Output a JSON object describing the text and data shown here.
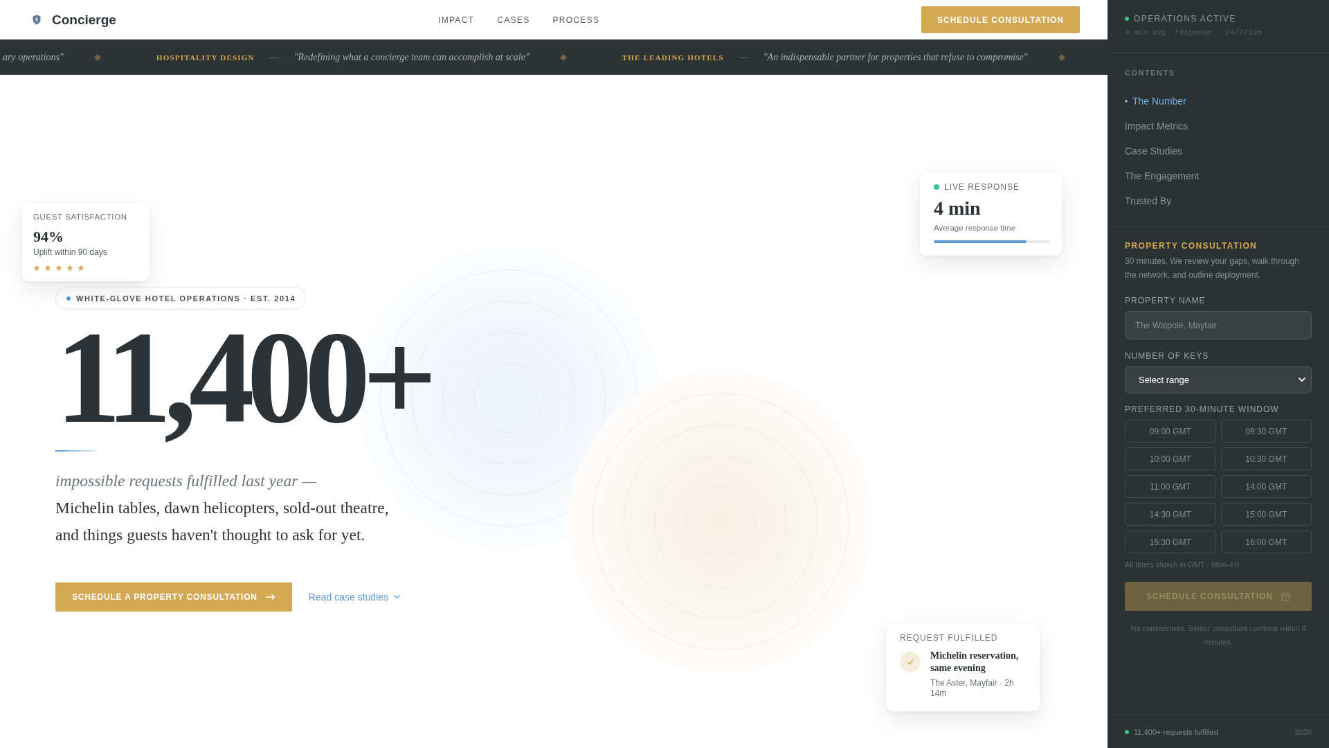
{
  "header": {
    "logo": "Concierge",
    "nav": [
      "IMPACT",
      "CASES",
      "PROCESS"
    ],
    "cta": "SCHEDULE CONSULTATION"
  },
  "ticker": {
    "entries": [
      {
        "quote": "ary operations\""
      },
      {
        "label": "HOSPITALITY DESIGN",
        "dash": "—",
        "quote": "\"Redefining what a concierge team can accomplish at scale\""
      },
      {
        "label": "THE LEADING HOTELS",
        "dash": "—",
        "quote": "\"An indispensable partner for properties that refuse to compromise\""
      }
    ]
  },
  "hero": {
    "badge": "WHITE-GLOVE HOTEL OPERATIONS · EST. 2014",
    "number": "11,400+",
    "lead": "impossible requests fulfilled last year —",
    "body": "Michelin tables, dawn helicopters, sold-out theatre, and things guests haven't thought to ask for yet.",
    "primary_button": "SCHEDULE A PROPERTY CONSULTATION",
    "secondary_link": "Read case studies"
  },
  "cards": [
    {
      "kind": "live",
      "title": "LIVE RESPONSE",
      "value": "4 min",
      "caption": "Average response time",
      "level": 0.8
    },
    {
      "kind": "satisfaction",
      "title": "GUEST SATISFACTION",
      "value": "94%",
      "caption": "Uplift within 90 days",
      "stars": 5
    },
    {
      "kind": "fulfilled",
      "title": "REQUEST FULFILLED",
      "headline": "Michelin reservation, same evening",
      "detail": "The Aster, Mayfair · 2h 14m"
    }
  ],
  "sidebar": {
    "status": {
      "title": "OPERATIONS ACTIVE",
      "detail": "4 min avg. response · 24/7/365"
    },
    "contents": {
      "heading": "CONTENTS",
      "items": [
        {
          "label": "The Number",
          "selected": true
        },
        {
          "label": "Impact Metrics",
          "selected": false
        },
        {
          "label": "Case Studies",
          "selected": false
        },
        {
          "label": "The Engagement",
          "selected": false
        },
        {
          "label": "Trusted By",
          "selected": false
        }
      ]
    },
    "form": {
      "title": "PROPERTY CONSULTATION",
      "description": "30 minutes. We review your gaps, walk through the network, and outline deployment.",
      "fields": [
        {
          "kind": "text",
          "label": "PROPERTY NAME",
          "placeholder": "The Walpole, Mayfair"
        },
        {
          "kind": "select",
          "label": "NUMBER OF KEYS",
          "value": "Select range"
        }
      ],
      "slots_label": "PREFERRED 30-MINUTE WINDOW",
      "slots": [
        {
          "label": "09:00 GMT",
          "selected": false
        },
        {
          "label": "09:30 GMT",
          "selected": false
        },
        {
          "label": "10:00 GMT",
          "selected": false
        },
        {
          "label": "10:30 GMT",
          "selected": false
        },
        {
          "label": "11:00 GMT",
          "selected": false
        },
        {
          "label": "14:00 GMT",
          "selected": false
        },
        {
          "label": "14:30 GMT",
          "selected": false
        },
        {
          "label": "15:00 GMT",
          "selected": false
        },
        {
          "label": "15:30 GMT",
          "selected": false
        },
        {
          "label": "16:00 GMT",
          "selected": false
        }
      ],
      "note": "All times shown in GMT · Mon–Fri",
      "submit": {
        "label": "SCHEDULE CONSULTATION",
        "disabled": true
      },
      "disclaimer": "No commitment. Senior consultant confirms within 4 minutes."
    },
    "footer": {
      "text": "11,400+ requests fulfilled",
      "year": "2026"
    }
  }
}
